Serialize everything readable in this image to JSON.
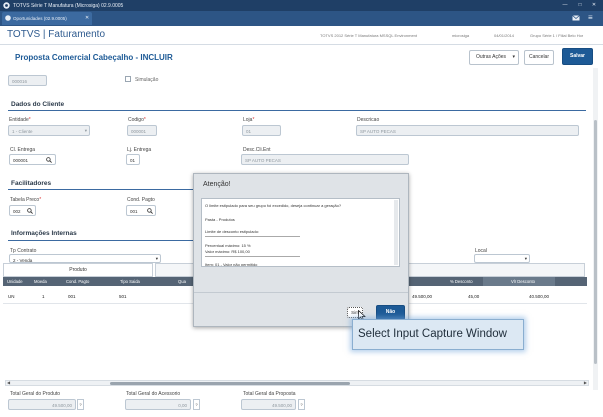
{
  "window": {
    "title": "TOTVS Série T Manufatura (Microsiga) 02.9.0005"
  },
  "tab": {
    "label": "Oportunidades (02.9.0005)"
  },
  "app": {
    "brand": "TOTVS | Faturamento",
    "info": [
      "TOTVS 2012 Série T Manufatura MSSQL Environment",
      "microsiga",
      "04/01/2014",
      "Grupo Série 1 / Filial Belo Hor"
    ]
  },
  "page": {
    "title": "Proposta Comercial Cabeçalho - INCLUIR"
  },
  "toolbar": {
    "more": "Outras Ações",
    "cancel": "Cancelar",
    "save": "Salvar"
  },
  "top": {
    "field_value": "000016",
    "checkbox_label": "Simulação"
  },
  "dados": {
    "title": "Dados do Cliente",
    "entidade": {
      "label": "Entidade",
      "value": "1 - Cliente"
    },
    "codigo": {
      "label": "Codigo",
      "value": "000001"
    },
    "loja": {
      "label": "Loja",
      "value": "01"
    },
    "descricao": {
      "label": "Descricao",
      "value": "SP AUTO PECAS"
    },
    "cl_entrega": {
      "label": "Cl. Entrega",
      "value": "000001"
    },
    "lj_entrega": {
      "label": "Lj. Entrega",
      "value": "01"
    },
    "desc_cli": {
      "label": "Desc.Cli.Ent",
      "value": "SP AUTO PECAS"
    }
  },
  "facilitadores": {
    "title": "Facilitadores",
    "tabela": {
      "label": "Tabela Preco",
      "value": "002"
    },
    "cond": {
      "label": "Cond. Pagto",
      "value": "001"
    }
  },
  "info": {
    "title": "Informações Internas",
    "contrato_label": "Tp Contrato",
    "contrato_value": "2 - Venda",
    "local_label": "Local"
  },
  "panels": {
    "produto": "Produto"
  },
  "grid": {
    "headers": [
      "Unidade",
      "Moeda",
      "Cond. Pagto",
      "Tipo Saida",
      "Qua",
      "",
      "% Desconto",
      "Vlr Desconto"
    ],
    "row": [
      "UN",
      "1",
      "001",
      "501",
      "",
      "49.500,00",
      "45,00",
      "40.500,00"
    ]
  },
  "dialog": {
    "title": "Atenção!",
    "lines": [
      "O limite estipulado para seu grupo foi excedido, deseja continuar a geração?",
      "Pasta - Produtos",
      "Limite de desconto estipulado:",
      "Percentual máximo: 15 %",
      "Valor máximo: R$ 100,00",
      "Item: 01 - Valor não permitido"
    ],
    "yes": "Sim",
    "no": "Não"
  },
  "tooltip": {
    "text": "Select Input Capture Window"
  },
  "totals": [
    {
      "label": "Total Geral do Produto",
      "value": "49.500,00"
    },
    {
      "label": "Total Geral do Acessorio",
      "value": "0,00"
    },
    {
      "label": "Total Geral da Proposta",
      "value": "49.500,00"
    }
  ],
  "colors": {
    "titlebar": "#1f3f66",
    "accent": "#1d5a96",
    "brand": "#2f5b8f"
  }
}
